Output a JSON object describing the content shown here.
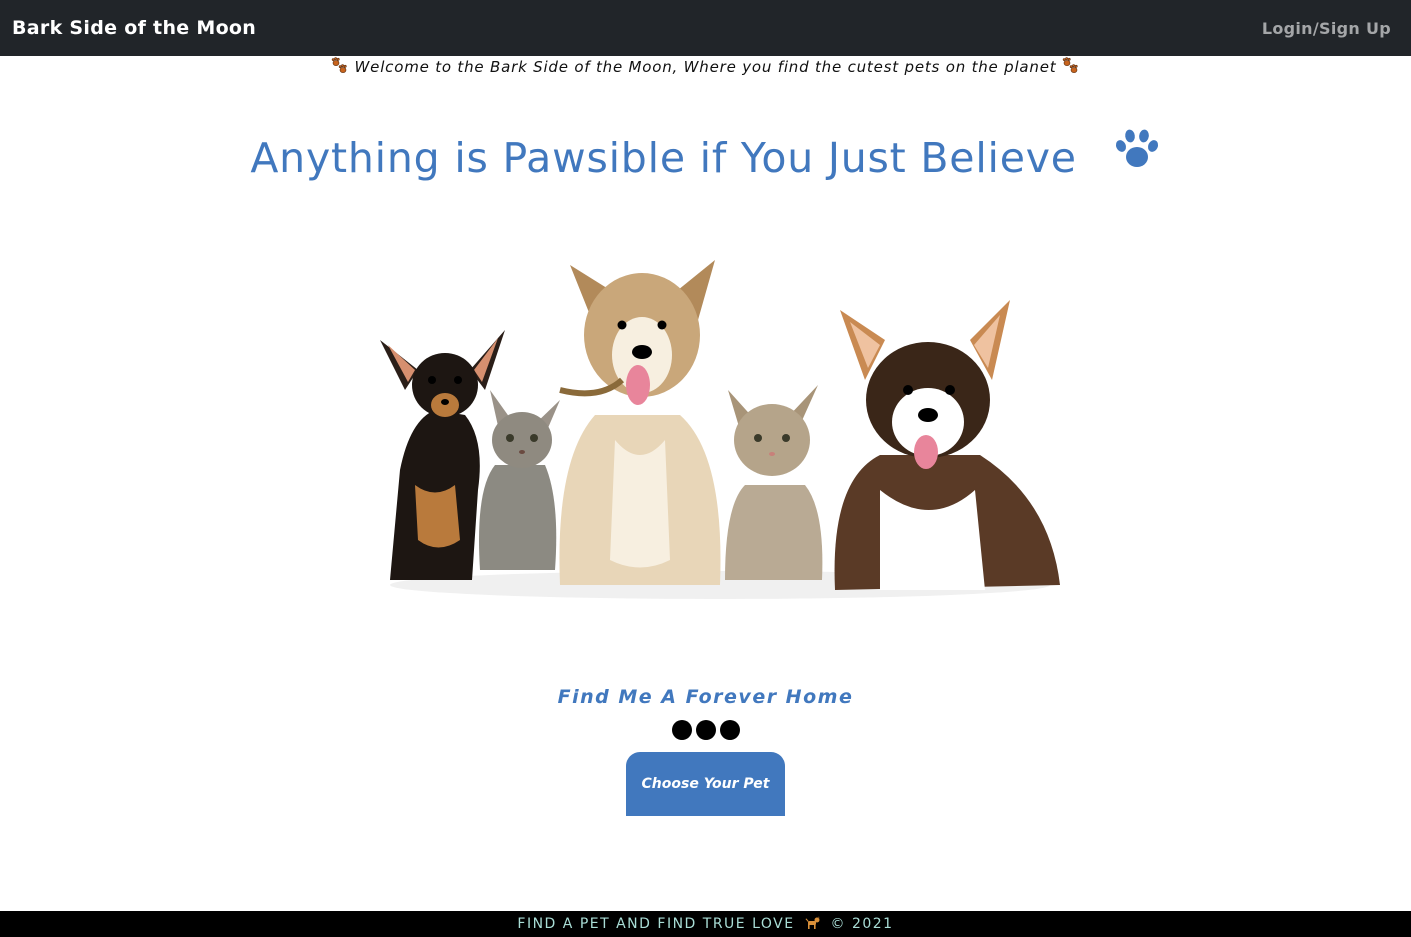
{
  "navbar": {
    "brand": "Bark Side of the Moon",
    "login_link": "Login/Sign Up"
  },
  "welcome": {
    "text": "Welcome to the Bark Side of the Moon, Where you find the cutest pets on the planet"
  },
  "hero": {
    "headline": "Anything is Pawsible if You Just Believe",
    "headline_icon": "paw-icon",
    "image_icon": "pets-group-image"
  },
  "cta": {
    "tagline": "Find Me A Forever Home",
    "button_label": "Choose Your Pet"
  },
  "footer": {
    "text_left": "FIND A PET AND FIND TRUE LOVE",
    "text_right": "© 2021",
    "icon": "dog-icon"
  },
  "colors": {
    "navbar_bg": "#212529",
    "accent_blue": "#4178be",
    "footer_bg": "#000000",
    "footer_text": "#a9ddd6"
  }
}
